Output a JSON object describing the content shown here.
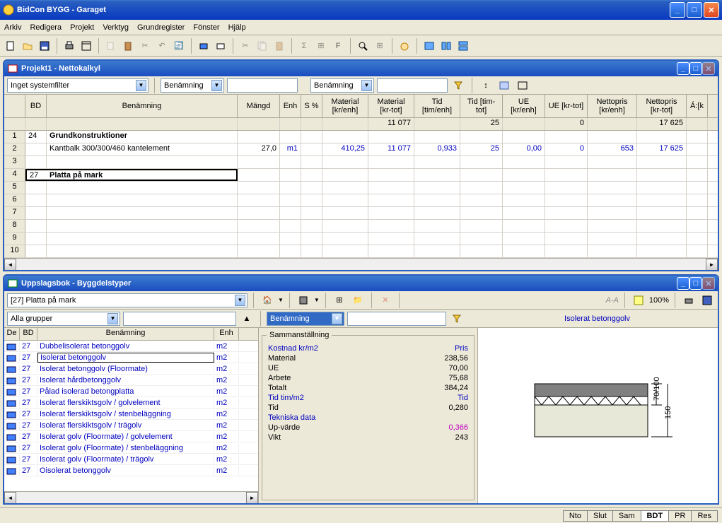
{
  "app": {
    "title": "BidCon BYGG - Garaget"
  },
  "menu": [
    "Arkiv",
    "Redigera",
    "Projekt",
    "Verktyg",
    "Grundregister",
    "Fönster",
    "Hjälp"
  ],
  "project_window": {
    "title": "Projekt1  - Nettokalkyl",
    "filters": {
      "system_filter": "Inget systemfilter",
      "col1": "Benämning",
      "col2": "Benämning"
    },
    "columns": [
      "",
      "BD",
      "Benämning",
      "Mängd",
      "Enh",
      "S %",
      "Material [kr/enh]",
      "Material [kr-tot]",
      "Tid [tim/enh]",
      "Tid [tim-tot]",
      "UE [kr/enh]",
      "UE [kr-tot]",
      "Nettopris [kr/enh]",
      "Nettopris [kr-tot]",
      "Á:[k"
    ],
    "totals": {
      "mat_tot": "11 077",
      "tid_tot": "25",
      "ue_tot": "0",
      "netto_tot": "17 625"
    },
    "rows": [
      {
        "n": "1",
        "bd": "24",
        "name": "Grundkonstruktioner",
        "bold": true
      },
      {
        "n": "2",
        "bd": "",
        "name": "Kantbalk 300/300/460 kantelement",
        "mangd": "27,0",
        "enh": "m1",
        "mat_enh": "410,25",
        "mat_tot": "11 077",
        "tid_enh": "0,933",
        "tid_tot": "25",
        "ue_enh": "0,00",
        "ue_tot": "0",
        "np_enh": "653",
        "np_tot": "17 625"
      },
      {
        "n": "3"
      },
      {
        "n": "4",
        "bd": "27",
        "name": "Platta på mark",
        "bold": true,
        "selected": true
      },
      {
        "n": "5"
      },
      {
        "n": "6"
      },
      {
        "n": "7"
      },
      {
        "n": "8"
      },
      {
        "n": "9"
      },
      {
        "n": "10"
      }
    ]
  },
  "lookup_window": {
    "title": "Uppslagsbok - Byggdelstyper",
    "category": "[27]  Platta på mark",
    "group_filter": "Alla grupper",
    "search_col": "Benämning",
    "zoom": "100%",
    "list_columns": [
      "De",
      "BD",
      "Benämning",
      "Enh"
    ],
    "items": [
      {
        "bd": "27",
        "name": "Dubbelisolerat betonggolv",
        "enh": "m2"
      },
      {
        "bd": "27",
        "name": "Isolerat betonggolv",
        "enh": "m2",
        "selected": true
      },
      {
        "bd": "27",
        "name": "Isolerat betonggolv (Floormate)",
        "enh": "m2"
      },
      {
        "bd": "27",
        "name": "Isolerat hårdbetonggolv",
        "enh": "m2"
      },
      {
        "bd": "27",
        "name": "Pålad isolerad betongplatta",
        "enh": "m2"
      },
      {
        "bd": "27",
        "name": "Isolerat flerskiktsgolv / golvelement",
        "enh": "m2"
      },
      {
        "bd": "27",
        "name": "Isolerat flerskiktsgolv / stenbeläggning",
        "enh": "m2"
      },
      {
        "bd": "27",
        "name": "Isolerat flerskiktsgolv / trägolv",
        "enh": "m2"
      },
      {
        "bd": "27",
        "name": "Isolerat golv (Floormate) / golvelement",
        "enh": "m2"
      },
      {
        "bd": "27",
        "name": "Isolerat golv (Floormate) / stenbeläggning",
        "enh": "m2"
      },
      {
        "bd": "27",
        "name": "Isolerat golv (Floormate) / trägolv",
        "enh": "m2"
      },
      {
        "bd": "27",
        "name": "Oisolerat betonggolv",
        "enh": "m2"
      }
    ],
    "summary": {
      "title": "Sammanställning",
      "rows": [
        {
          "lbl": "Kostnad kr/m2",
          "val": "Pris",
          "hdr": true
        },
        {
          "lbl": "Material",
          "val": "238,56"
        },
        {
          "lbl": "UE",
          "val": "70,00"
        },
        {
          "lbl": "Arbete",
          "val": "75,68"
        },
        {
          "lbl": "Totalt",
          "val": "384,24"
        },
        {
          "lbl": "Tid tim/m2",
          "val": "Tid",
          "hdr": true
        },
        {
          "lbl": "Tid",
          "val": "0,280"
        },
        {
          "lbl": "Tekniska data",
          "val": "",
          "hdr": true
        },
        {
          "lbl": "Up-värde",
          "val": "0,366",
          "pink": true
        },
        {
          "lbl": "Vikt",
          "val": "243"
        }
      ]
    },
    "preview_title": "Isolerat betonggolv",
    "dims": {
      "top": "70/100",
      "total": "150"
    }
  },
  "status_tabs": [
    "Nto",
    "Slut",
    "Sam",
    "BDT",
    "PR",
    "Res"
  ],
  "status_active": "BDT"
}
